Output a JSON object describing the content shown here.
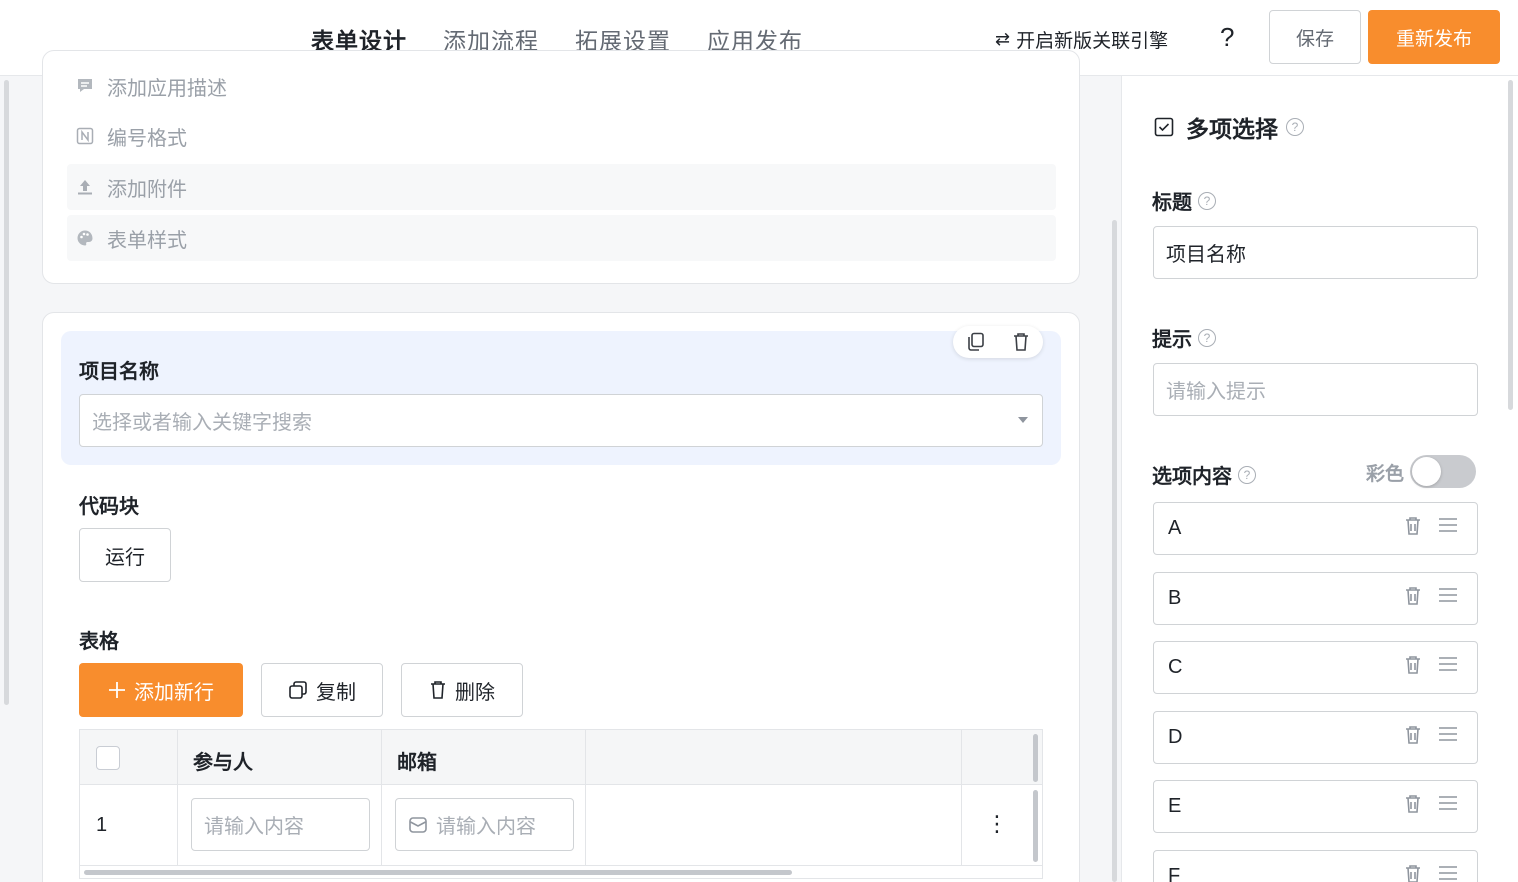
{
  "topbar": {
    "tabs": [
      {
        "label": "表单设计",
        "active": true
      },
      {
        "label": "添加流程",
        "active": false
      },
      {
        "label": "拓展设置",
        "active": false
      },
      {
        "label": "应用发布",
        "active": false
      }
    ],
    "engine_link": "开启新版关联引擎",
    "engine_icon": "⇄",
    "help": "?",
    "save_label": "保存",
    "publish_label": "重新发布",
    "accent_color": "#f88d2d"
  },
  "settings": {
    "items": [
      {
        "label": "添加应用描述",
        "icon": "comment-icon"
      },
      {
        "label": "编号格式",
        "icon": "number-icon"
      },
      {
        "label": "添加附件",
        "icon": "upload-icon"
      },
      {
        "label": "表单样式",
        "icon": "palette-icon"
      }
    ]
  },
  "form": {
    "project_field": {
      "label": "项目名称",
      "placeholder": "选择或者输入关键字搜索"
    },
    "code_block": {
      "label": "代码块",
      "run_label": "运行"
    },
    "table": {
      "label": "表格",
      "add_row_label": "添加新行",
      "copy_label": "复制",
      "delete_label": "删除",
      "columns": [
        "参与人",
        "邮箱"
      ],
      "rows": [
        {
          "index": "1",
          "participant_placeholder": "请输入内容",
          "email_placeholder": "请输入内容"
        }
      ]
    }
  },
  "panel": {
    "title": "多项选择",
    "title_label": "标题",
    "title_value": "项目名称",
    "hint_label": "提示",
    "hint_placeholder": "请输入提示",
    "options_label": "选项内容",
    "color_label": "彩色",
    "color_enabled": false,
    "options": [
      "A",
      "B",
      "C",
      "D",
      "E",
      "F"
    ]
  }
}
